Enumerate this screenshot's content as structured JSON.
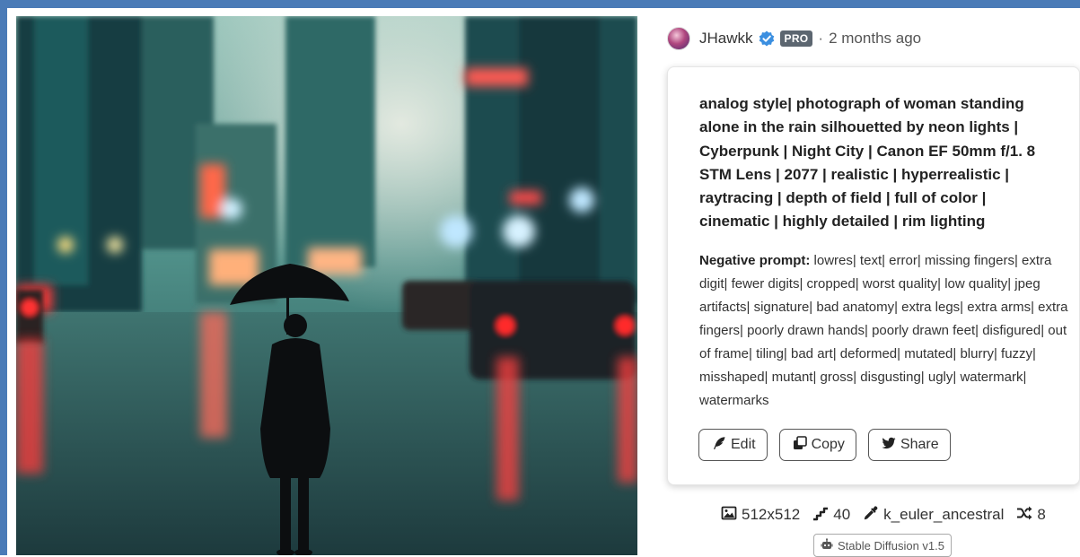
{
  "post": {
    "username": "JHawkk",
    "pro_badge": "PRO",
    "separator": "·",
    "time": "2 months ago"
  },
  "prompt": "analog style| photograph of woman standing alone in the rain silhouetted by neon lights | Cyberpunk | Night City | Canon EF 50mm f/1. 8 STM Lens | 2077 | realistic | hyperrealistic | raytracing | depth of field | full of color | cinematic | highly detailed | rim lighting",
  "negative": {
    "label": "Negative prompt:",
    "text": " lowres| text| error| missing fingers| extra digit| fewer digits| cropped| worst quality| low quality| jpeg artifacts| signature| bad anatomy| extra legs| extra arms| extra fingers| poorly drawn hands| poorly drawn feet| disfigured| out of frame| tiling| bad art| deformed| mutated| blurry| fuzzy| misshaped| mutant| gross| disgusting| ugly| watermark| watermarks"
  },
  "actions": {
    "edit": "Edit",
    "copy": "Copy",
    "share": "Share"
  },
  "stats": {
    "size": "512x512",
    "steps": "40",
    "sampler": "k_euler_ancestral",
    "seed_label": "8"
  },
  "model": "Stable Diffusion v1.5",
  "icons": {
    "verified": "verified-check-icon",
    "edit": "feather-icon",
    "copy": "copy-icon",
    "share": "twitter-icon",
    "size": "image-icon",
    "steps": "steps-icon",
    "sampler": "eyedropper-icon",
    "seed": "shuffle-icon",
    "model": "robot-icon"
  },
  "colors": {
    "frame": "#4a7bb7",
    "verified": "#3b8fe0",
    "pro_badge": "#5c6670"
  }
}
